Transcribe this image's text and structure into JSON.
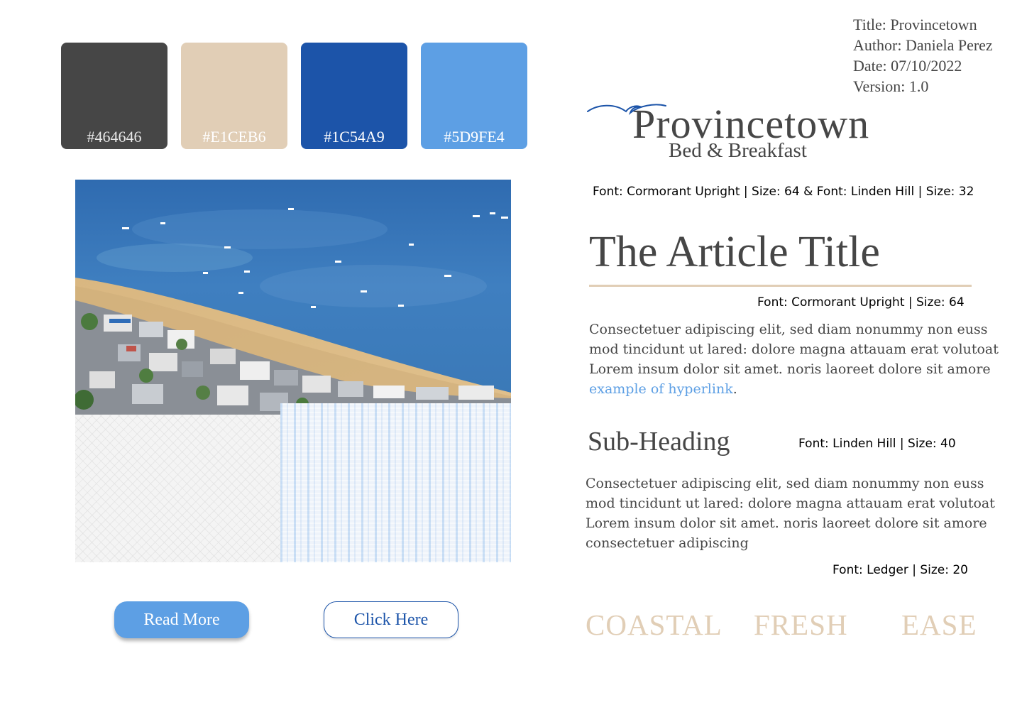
{
  "meta": {
    "title": "Title: Provincetown",
    "author": "Author: Daniela Perez",
    "date": "Date: 07/10/2022",
    "version": "Version: 1.0"
  },
  "palette": [
    {
      "hex": "#464646",
      "label": "#464646",
      "label_color": "#e8e8e8"
    },
    {
      "hex": "#E1CEB6",
      "label": "#E1CEB6",
      "label_color": "#ffffff"
    },
    {
      "hex": "#1C54A9",
      "label": "#1C54A9",
      "label_color": "#ffffff"
    },
    {
      "hex": "#5D9FE4",
      "label": "#5D9FE4",
      "label_color": "#ffffff"
    }
  ],
  "logo": {
    "main": "Provincetown",
    "sub": "Bed & Breakfast",
    "font_note": "Font: Cormorant Upright | Size: 64 & Font: Linden Hill | Size: 32"
  },
  "article": {
    "title": "The Article Title",
    "title_font_note": "Font: Cormorant Upright | Size: 64",
    "paragraph1": [
      "Consectetuer adipiscing elit, sed diam nonummy non euss",
      "mod tincidunt ut lared: dolore magna attauam erat volutoat",
      "Lorem insum dolor sit amet. noris laoreet dolore sit amore"
    ],
    "hyperlink": "example of hyperlink",
    "hyperlink_trailing": ".",
    "subheading": "Sub-Heading",
    "subheading_font_note": "Font: Linden Hill | Size: 40",
    "paragraph2": [
      "Consectetuer adipiscing elit, sed diam nonummy non euss",
      "mod tincidunt ut lared: dolore magna attauam erat volutoat",
      "Lorem insum dolor sit amet. noris laoreet dolore sit amore",
      "consectetuer adipiscing"
    ],
    "body_font_note": "Font: Ledger | Size: 20"
  },
  "buttons": {
    "read_more": "Read More",
    "click_here": "Click Here"
  },
  "keywords": [
    "COASTAL",
    "FRESH",
    "EASE"
  ],
  "colors": {
    "dark": "#464646",
    "sand": "#E1CEB6",
    "navy": "#1C54A9",
    "sky": "#5D9FE4"
  }
}
